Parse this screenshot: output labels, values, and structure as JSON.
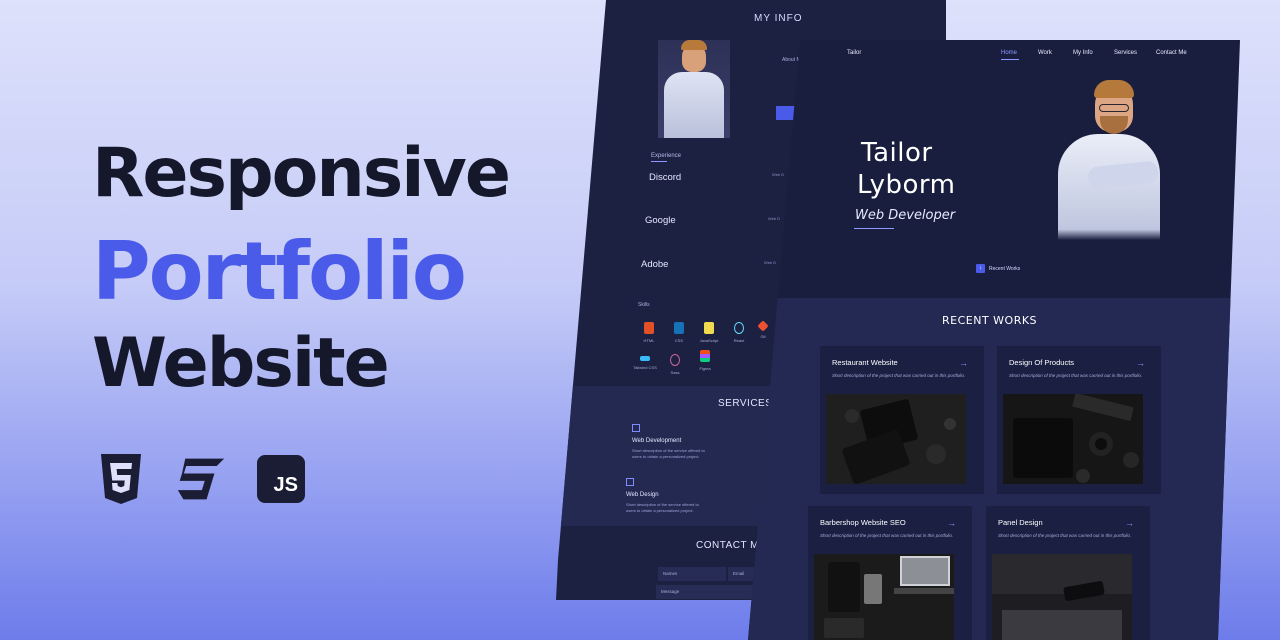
{
  "hero": {
    "line1": "Responsive",
    "line2": "Portfolio",
    "line3": "Website"
  },
  "tech": {
    "js_label": "JS"
  },
  "back_page": {
    "section_title": "MY INFO",
    "about_label": "About M",
    "experience_label": "Experience",
    "companies": [
      "Discord",
      "Google",
      "Adobe"
    ],
    "roles": [
      "Web D",
      "Web D",
      "Web D"
    ],
    "skills_label": "Skills",
    "skills": [
      "HTML",
      "CSS",
      "JavaScript",
      "React",
      "Git",
      "Tailwind CSS",
      "Sass",
      "Figma"
    ],
    "services_title": "SERVICES",
    "services": [
      {
        "title": "Web Development",
        "desc": "Short description of the service offered to users to obtain a personalized project."
      },
      {
        "title": "Web Design",
        "desc": "Short description of the service offered to users to obtain a personalized project."
      }
    ],
    "contact_title": "CONTACT M",
    "contact_fields": {
      "names": "Names",
      "email": "Email",
      "message": "Message"
    }
  },
  "front_page": {
    "brand": "Tailor",
    "nav": [
      "Home",
      "Work",
      "My Info",
      "Services",
      "Contact Me"
    ],
    "first_name": "Tailor",
    "last_name": "Lyborm",
    "role": "Web Developer",
    "recent_link": "Recent Works",
    "works_title": "RECENT WORKS",
    "works": [
      {
        "title": "Restaurant Website",
        "desc": "Short description of the project that was carried out in this portfolio."
      },
      {
        "title": "Design Of Products",
        "desc": "Short description of the project that was carried out in this portfolio."
      },
      {
        "title": "Barbershop Website SEO",
        "desc": "Short description of the project that was carried out in this portfolio."
      },
      {
        "title": "Panel Design",
        "desc": "Short description of the project that was carried out in this portfolio."
      }
    ]
  },
  "colors": {
    "accent": "#4a5bea",
    "dark_text": "#15172a",
    "page_bg": "#1a1e3e",
    "band_bg": "#232952"
  }
}
